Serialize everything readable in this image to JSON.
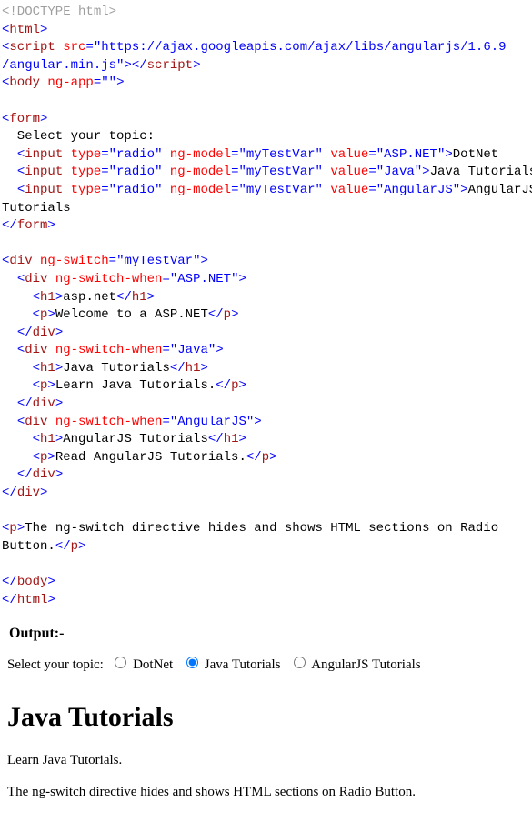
{
  "code": {
    "doctype": "<!DOCTYPE html>",
    "html_open": "html",
    "script_open": "script",
    "src_attr": "src",
    "src_val": "\"https://ajax.googleapis.com/ajax/libs/angularjs/1.6.9",
    "src_val2": "/angular.min.js\"",
    "script_close": "script",
    "body_open": "body",
    "ngapp_attr": "ng-app",
    "ngapp_val": "\"\"",
    "form_open": "form",
    "form_text": "  Select your topic:",
    "input": "input",
    "type_attr": "type",
    "radio_val": "\"radio\"",
    "ngmodel_attr": "ng-model",
    "ngmodel_val": "\"myTestVar\"",
    "value_attr": "value",
    "val_asp": "\"ASP.NET\"",
    "lbl_asp": "DotNet",
    "val_java": "\"Java\"",
    "lbl_java": "Java Tutorials",
    "val_ang": "\"AngularJS\"",
    "lbl_ang": "AngularJS",
    "lbl_ang2": "Tutorials",
    "form_close": "form",
    "div": "div",
    "ngswitch_attr": "ng-switch",
    "ngswitch_val": "\"myTestVar\"",
    "ngswitchwhen_attr": "ng-switch-when",
    "h1": "h1",
    "p": "p",
    "case1_h1": "asp.net",
    "case1_p": "Welcome to a ASP.NET",
    "case2_h1": "Java Tutorials",
    "case2_p": "Learn Java Tutorials.",
    "case3_h1": "AngularJS Tutorials",
    "case3_p": "Read AngularJS Tutorials.",
    "note_text": "The ng-switch directive hides and shows HTML sections on Radio",
    "note_text2": "Button.",
    "body_close": "body",
    "html_close": "html"
  },
  "output": {
    "label": "Output:-",
    "prompt": "Select your topic:",
    "opt1": "DotNet",
    "opt2": "Java Tutorials",
    "opt3": "AngularJS Tutorials",
    "heading": "Java Tutorials",
    "para": "Learn Java Tutorials.",
    "note": "The ng-switch directive hides and shows HTML sections on Radio Button."
  }
}
